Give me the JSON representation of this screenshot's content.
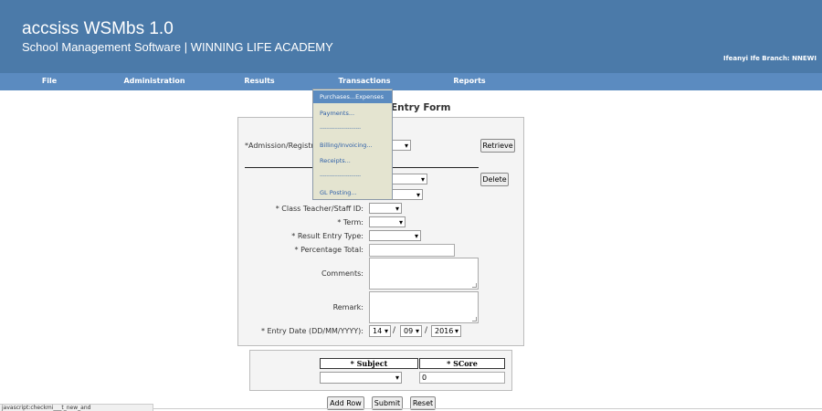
{
  "header": {
    "title": "accsiss WSMbs 1.0",
    "subtitle": "School Management Software | WINNING LIFE ACADEMY",
    "branch": "Ifeanyi Ife Branch: NNEWI"
  },
  "menu": {
    "items": [
      "File",
      "Administration",
      "Results",
      "Transactions",
      "Reports"
    ]
  },
  "dropdown": {
    "items": [
      "Purchases...Expenses",
      "Payments...",
      "Billing/Invoicing...",
      "Receipts...",
      "GL Posting..."
    ],
    "separator": "-------------------------"
  },
  "form": {
    "title": "Entry Form",
    "admission_label": "*Admission/Registr",
    "retrieve": "Retrieve",
    "delete": "Delete",
    "class_teacher_label": "* Class Teacher/Staff ID:",
    "term_label": "* Term:",
    "result_entry_type_label": "* Result Entry Type:",
    "percentage_total_label": "* Percentage Total:",
    "comments_label": "Comments:",
    "remark_label": "Remark:",
    "entry_date_label": "* Entry Date (DD/MM/YYYY):",
    "date": {
      "day": "14",
      "month": "09",
      "year": "2016",
      "sep": "/"
    }
  },
  "subjects": {
    "subject_header": "* Subject",
    "score_header": "* SCore",
    "score_value": "0"
  },
  "actions": {
    "add_row": "Add Row",
    "submit": "Submit",
    "reset": "Reset"
  },
  "status": {
    "text": "javascript:checkmi___t_new_and"
  }
}
